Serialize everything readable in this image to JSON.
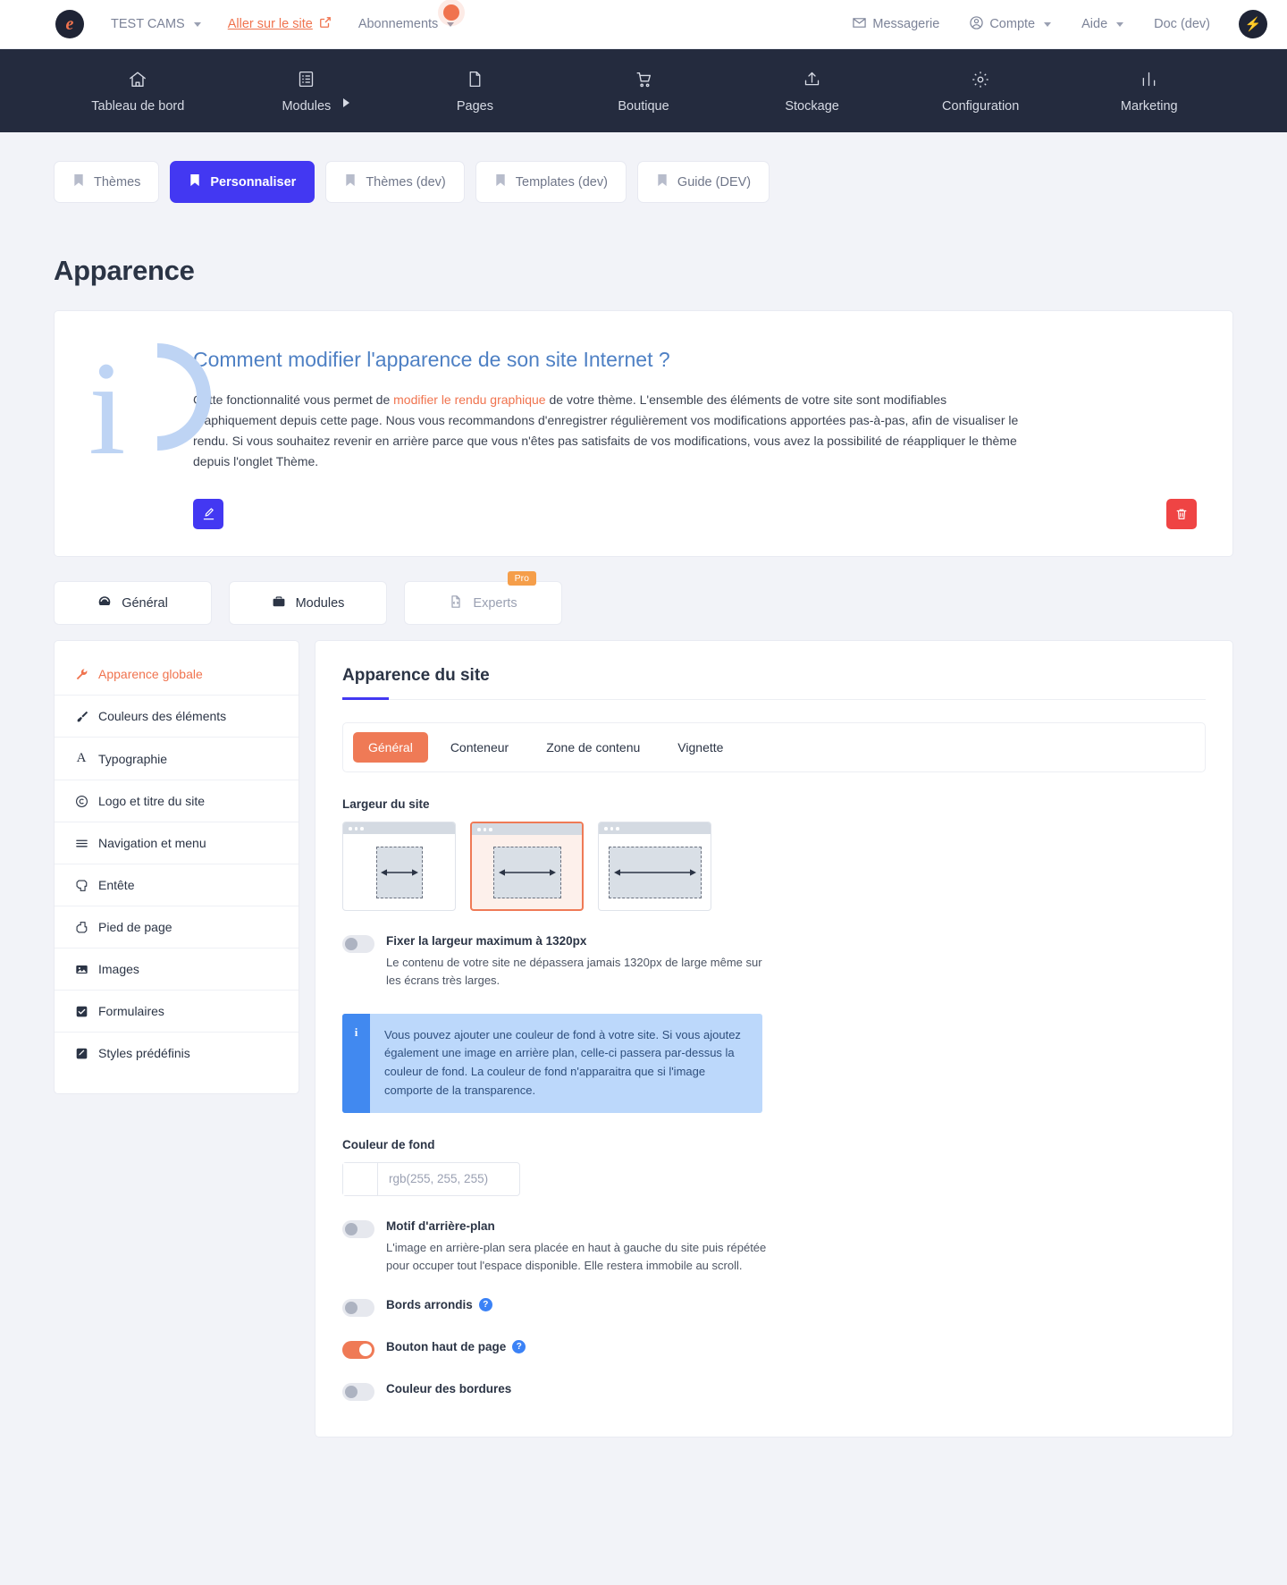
{
  "topbar": {
    "logo_icon": "e-logo-icon",
    "site_name": "TEST CAMS",
    "goto_site": "Aller sur le site",
    "goto_site_icon": "external-link-icon",
    "subscriptions": "Abonnements",
    "messaging": "Messagerie",
    "messaging_icon": "envelope-icon",
    "account": "Compte",
    "account_icon": "user-circle-icon",
    "help": "Aide",
    "doc": "Doc (dev)",
    "avatar_icon": "lightning-bolt-icon"
  },
  "nav": {
    "items": [
      {
        "label": "Tableau de bord",
        "icon": "home-icon"
      },
      {
        "label": "Modules",
        "icon": "list-icon"
      },
      {
        "label": "Pages",
        "icon": "file-icon"
      },
      {
        "label": "Boutique",
        "icon": "cart-icon"
      },
      {
        "label": "Stockage",
        "icon": "upload-icon"
      },
      {
        "label": "Configuration",
        "icon": "gear-icon"
      },
      {
        "label": "Marketing",
        "icon": "chart-bar-icon"
      }
    ]
  },
  "tabs": [
    {
      "label": "Thèmes",
      "active": false
    },
    {
      "label": "Personnaliser",
      "active": true
    },
    {
      "label": "Thèmes (dev)",
      "active": false
    },
    {
      "label": "Templates (dev)",
      "active": false
    },
    {
      "label": "Guide (DEV)",
      "active": false
    }
  ],
  "page_title": "Apparence",
  "info_card": {
    "heading": "Comment modifier l'apparence de son site Internet ?",
    "paragraph_1": "Cette fonctionnalité vous permet de ",
    "paragraph_link": "modifier le rendu graphique",
    "paragraph_2": " de votre thème. L'ensemble des éléments de votre site sont modifiables graphiquement depuis cette page. Nous vous recommandons d'enregistrer régulièrement vos modifications apportées pas-à-pas, afin de visualiser le rendu. Si vous souhaitez revenir en arrière parce que vous n'êtes pas satisfaits de vos modifications, vous avez la possibilité de réappliquer le thème depuis l'onglet Thème.",
    "edit_icon": "edit-square-icon",
    "delete_icon": "trash-icon"
  },
  "segments": [
    {
      "label": "Général",
      "icon": "dashboard-icon",
      "badge": ""
    },
    {
      "label": "Modules",
      "icon": "briefcase-icon",
      "badge": ""
    },
    {
      "label": "Experts",
      "icon": "code-file-icon",
      "badge": "Pro"
    }
  ],
  "sidebar": {
    "items": [
      {
        "label": "Apparence globale",
        "icon": "wrench-icon",
        "active": true
      },
      {
        "label": "Couleurs des éléments",
        "icon": "paintbrush-icon",
        "active": false
      },
      {
        "label": "Typographie",
        "icon": "font-a-icon",
        "active": false
      },
      {
        "label": "Logo et titre du site",
        "icon": "copyright-icon",
        "active": false
      },
      {
        "label": "Navigation et menu",
        "icon": "hamburger-icon",
        "active": false
      },
      {
        "label": "Entête",
        "icon": "header-shape-icon",
        "active": false
      },
      {
        "label": "Pied de page",
        "icon": "footer-shape-icon",
        "active": false
      },
      {
        "label": "Images",
        "icon": "image-icon",
        "active": false
      },
      {
        "label": "Formulaires",
        "icon": "checkbox-icon",
        "active": false
      },
      {
        "label": "Styles prédéfinis",
        "icon": "pencil-square-icon",
        "active": false
      }
    ]
  },
  "main": {
    "heading": "Apparence du site",
    "pill_tabs": [
      {
        "label": "Général",
        "active": true
      },
      {
        "label": "Conteneur",
        "active": false
      },
      {
        "label": "Zone de contenu",
        "active": false
      },
      {
        "label": "Vignette",
        "active": false
      }
    ],
    "width_label": "Largeur du site",
    "width_options": [
      {
        "name": "narrow",
        "selected": false
      },
      {
        "name": "medium",
        "selected": true
      },
      {
        "name": "wide",
        "selected": false
      }
    ],
    "max_width_toggle": {
      "label": "Fixer la largeur maximum à 1320px",
      "description": "Le contenu de votre site ne dépassera jamais 1320px de large même sur les écrans très larges.",
      "on": false
    },
    "callout": {
      "icon": "info-icon",
      "text": "Vous pouvez ajouter une couleur de fond à votre site. Si vous ajoutez également une image en arrière plan, celle-ci passera par-dessus la couleur de fond. La couleur de fond n'apparaitra que si l'image comporte de la transparence."
    },
    "bg_color": {
      "label": "Couleur de fond",
      "value": "rgb(255, 255, 255)",
      "swatch_hex": "#ffffff"
    },
    "toggles": [
      {
        "label": "Motif d'arrière-plan",
        "description": "L'image en arrière-plan sera placée en haut à gauche du site puis répétée pour occuper tout l'espace disponible. Elle restera immobile au scroll.",
        "on": false,
        "help": false
      },
      {
        "label": "Bords arrondis",
        "description": "",
        "on": false,
        "help": true
      },
      {
        "label": "Bouton haut de page",
        "description": "",
        "on": true,
        "help": true
      },
      {
        "label": "Couleur des bordures",
        "description": "",
        "on": false,
        "help": false
      }
    ]
  },
  "colors": {
    "accent_orange": "#ef7a56",
    "accent_blue": "#4338f2",
    "nav_dark": "#242b3e",
    "danger_red": "#ef4444",
    "info_blue": "#4189f0"
  }
}
